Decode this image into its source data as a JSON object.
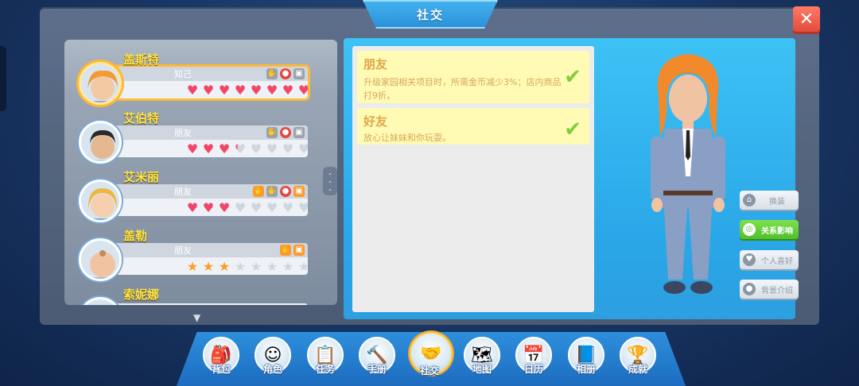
{
  "window": {
    "title": "社交",
    "close_glyph": "✕"
  },
  "npcs": [
    {
      "name": "盖斯特",
      "relation": "知己",
      "selected": true,
      "tags": [
        "gift-shake-icon",
        "chat-icon",
        "gift-box-icon"
      ],
      "rating": {
        "type": "hearts",
        "filled": 9,
        "total": 10
      }
    },
    {
      "name": "艾伯特",
      "relation": "朋友",
      "selected": false,
      "tags": [
        "gift-shake-icon",
        "chat-icon",
        "gift-box-icon"
      ],
      "rating": {
        "type": "hearts",
        "filled": 3.5,
        "total": 10
      }
    },
    {
      "name": "艾米丽",
      "relation": "朋友",
      "selected": false,
      "tags": [
        "hand-icon",
        "gift-shake-icon",
        "chat-icon",
        "gift-box-icon"
      ],
      "rating": {
        "type": "hearts",
        "filled": 3,
        "total": 10
      }
    },
    {
      "name": "盖勒",
      "relation": "朋友",
      "selected": false,
      "tags": [
        "hand-icon",
        "gift-box-icon"
      ],
      "rating": {
        "type": "stars",
        "filled": 3,
        "total": 10
      }
    },
    {
      "name": "索妮娜",
      "relation": "",
      "selected": false,
      "tags": [],
      "rating": null
    }
  ],
  "effects": [
    {
      "title": "朋友",
      "desc": "升级家园相关项目时，所需金币减少3%；店内商品打9折。",
      "unlocked": true
    },
    {
      "title": "好友",
      "desc": "放心让妹妹和你玩耍。",
      "unlocked": true
    }
  ],
  "side_buttons": [
    {
      "label": "换装",
      "icon": "home-icon",
      "active": false
    },
    {
      "label": "关系影响",
      "icon": "target-icon",
      "active": true
    },
    {
      "label": "个人喜好",
      "icon": "heart-icon",
      "active": false
    },
    {
      "label": "背景介绍",
      "icon": "person-icon",
      "active": false
    }
  ],
  "nav": [
    {
      "label": "背包",
      "icon": "backpack-icon",
      "glyph": "🎒",
      "active": false
    },
    {
      "label": "角色",
      "icon": "character-icon",
      "glyph": "☺",
      "active": false
    },
    {
      "label": "任务",
      "icon": "task-icon",
      "glyph": "📋",
      "active": false
    },
    {
      "label": "手册",
      "icon": "hammer-icon",
      "glyph": "🔨",
      "active": false
    },
    {
      "label": "社交",
      "icon": "handshake-icon",
      "glyph": "🤝",
      "active": true
    },
    {
      "label": "地图",
      "icon": "map-icon",
      "glyph": "🗺",
      "active": false
    },
    {
      "label": "日历",
      "icon": "calendar-icon",
      "glyph": "📅",
      "active": false
    },
    {
      "label": "相册",
      "icon": "album-icon",
      "glyph": "📘",
      "active": false
    },
    {
      "label": "成就",
      "icon": "trophy-icon",
      "glyph": "🏆",
      "active": false
    }
  ],
  "colors": {
    "accent": "#2aa7e8",
    "heart": "#f2456a",
    "star": "#ff9d1f",
    "name": "#ffe44d",
    "effect_text": "#e0a74a",
    "active_button": "#4fc02a"
  }
}
